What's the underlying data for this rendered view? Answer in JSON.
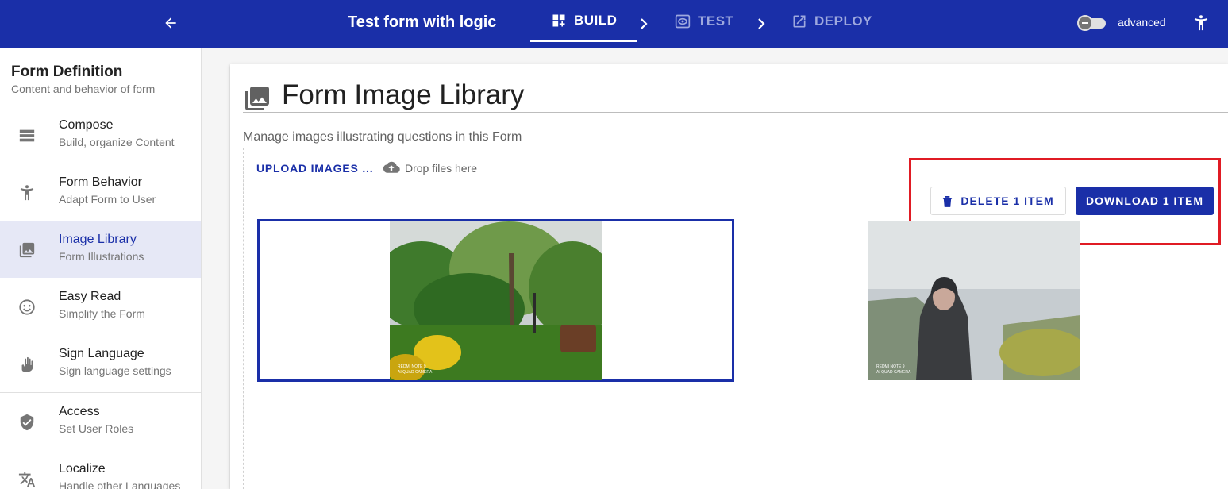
{
  "app": {
    "title": "Test form with logic",
    "steps": [
      {
        "label": "BUILD",
        "icon": "build-icon"
      },
      {
        "label": "TEST",
        "icon": "eye-icon"
      },
      {
        "label": "DEPLOY",
        "icon": "open-in-new-icon"
      }
    ],
    "toggle_label": "advanced"
  },
  "sidebar": {
    "title": "Form Definition",
    "subtitle": "Content and behavior of form",
    "items": [
      {
        "label": "Compose",
        "desc": "Build, organize Content",
        "icon": "compose-icon"
      },
      {
        "label": "Form Behavior",
        "desc": "Adapt Form to User",
        "icon": "accessibility-icon"
      },
      {
        "label": "Image Library",
        "desc": "Form Illustrations",
        "icon": "image-library-icon"
      },
      {
        "label": "Easy Read",
        "desc": "Simplify the Form",
        "icon": "smiley-icon"
      },
      {
        "label": "Sign Language",
        "desc": "Sign language settings",
        "icon": "sign-language-icon"
      },
      {
        "label": "Access",
        "desc": "Set User Roles",
        "icon": "shield-icon"
      },
      {
        "label": "Localize",
        "desc": "Handle other Languages",
        "icon": "translate-icon"
      }
    ],
    "selected_index": 2
  },
  "main": {
    "title": "Form Image Library",
    "description": "Manage images illustrating questions in this Form",
    "upload_label": "UPLOAD IMAGES ...",
    "drop_label": "Drop files here",
    "delete_label": "DELETE 1 ITEM",
    "download_label": "DOWNLOAD 1 ITEM",
    "images": [
      {
        "caption": "REDMI NOTE 9\nAI QUAD CAMERA",
        "selected": true
      },
      {
        "caption": "REDMI NOTE 9\nAI QUAD CAMERA",
        "selected": false
      }
    ]
  },
  "colors": {
    "brand": "#1a2fa8",
    "highlight": "#e01b24"
  }
}
